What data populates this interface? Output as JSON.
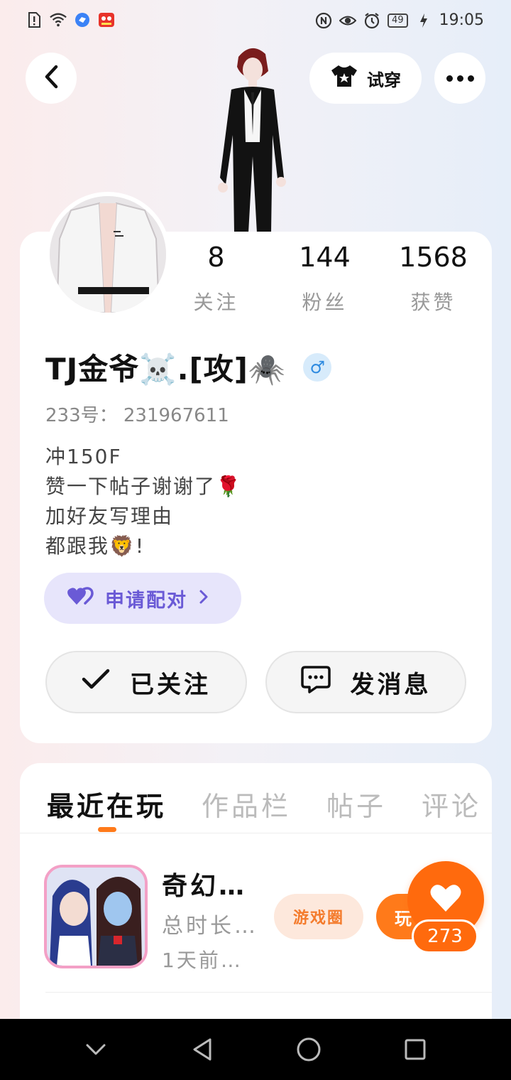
{
  "status_bar": {
    "time": "19:05",
    "battery": "49"
  },
  "header": {
    "try_on_label": "试穿"
  },
  "profile": {
    "stats": [
      {
        "value": "8",
        "label": "关注"
      },
      {
        "value": "144",
        "label": "粉丝"
      },
      {
        "value": "1568",
        "label": "获赞"
      }
    ],
    "name": "TJ金爷☠️.[攻]🕷️",
    "gender_symbol": "♂",
    "uid": "233号： 231967611",
    "bio": [
      "冲150F",
      "赞一下帖子谢谢了🌹",
      "加好友写理由",
      "都跟我🦁!"
    ],
    "match_label": "申请配对",
    "follow_label": "已关注",
    "message_label": "发消息"
  },
  "tabs": [
    {
      "label": "最近在玩",
      "active": true
    },
    {
      "label": "作品栏",
      "active": false
    },
    {
      "label": "帖子",
      "active": false
    },
    {
      "label": "评论",
      "active": false
    }
  ],
  "recent_game": {
    "title": "奇幻…",
    "playtime": "总时长…",
    "last_played": "1天前…",
    "circle_label": "游戏圈",
    "play_label": "玩"
  },
  "like": {
    "count": "273"
  },
  "colors": {
    "accent_orange": "#ff6a0d",
    "match_purple": "#6a5ad6",
    "gender_blue": "#2f8be0"
  }
}
